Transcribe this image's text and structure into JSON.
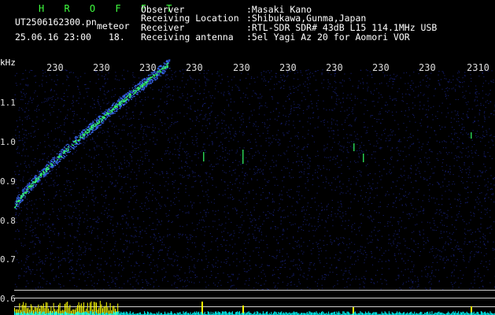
{
  "header": {
    "title": "H R O F F T",
    "file_name": "UT2506162300.pn",
    "datetime": "25.06.16 23:00",
    "mode_label": "meteor",
    "counter": "18.",
    "observer_label": "Observer",
    "observer_value": ":Masaki Kano",
    "location_label": "Receiving Location",
    "location_value": ":Shibukawa,Gunma,Japan",
    "receiver_label": "Receiver",
    "receiver_value": ":RTL-SDR SDR# 43dB L15 114.1MHz USB",
    "antenna_label": "Receiving antenna",
    "antenna_value": ":5el Yagi Az 20 for Aomori VOR"
  },
  "axis": {
    "unit_label": "kHz",
    "time_ticks": [
      "230",
      "230",
      "230",
      "230",
      "230",
      "230",
      "230",
      "230",
      "230",
      "2310"
    ],
    "freq_ticks": [
      "1.1",
      "1.0",
      "0.9",
      "0.8",
      "0.7",
      "0.6"
    ]
  },
  "colors": {
    "background": "#000000",
    "noise": "#1e2a9a",
    "meteor": "#33ff66",
    "power_bar": "#ffff00",
    "baseline": "#00ffff",
    "grid_line": "#cfcfcf"
  }
}
